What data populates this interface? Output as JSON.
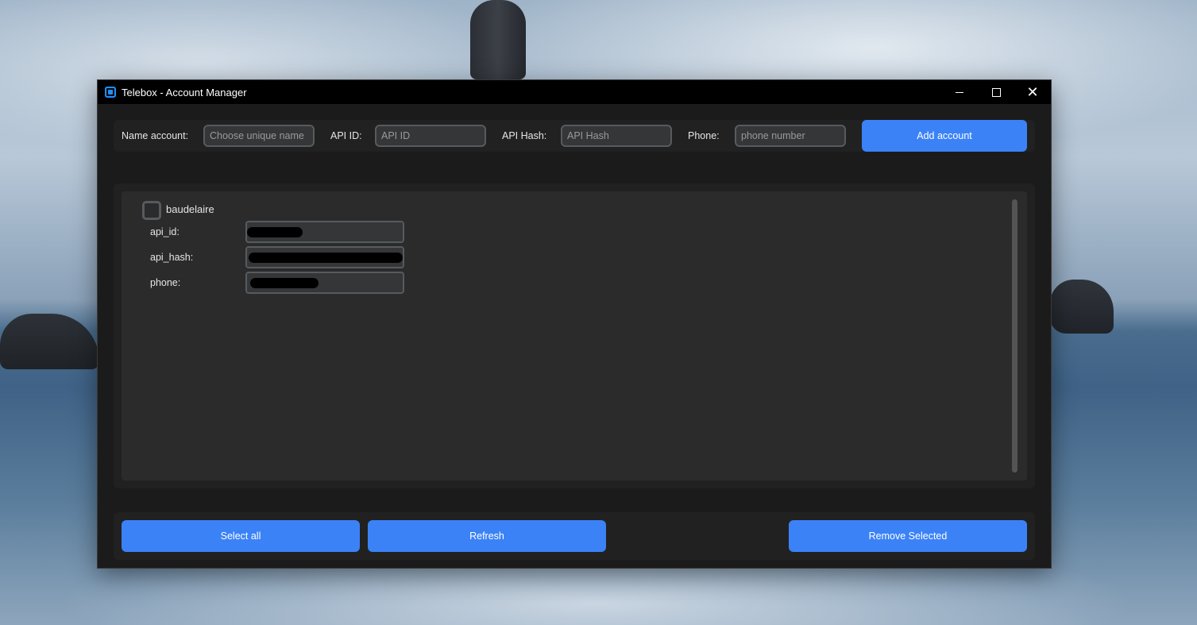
{
  "window": {
    "title": "Telebox - Account Manager",
    "close_glyph": "✕"
  },
  "form": {
    "name_label": "Name account:",
    "name_placeholder": "Choose unique name",
    "api_id_label": "API ID:",
    "api_id_placeholder": "API ID",
    "api_hash_label": "API Hash:",
    "api_hash_placeholder": "API Hash",
    "phone_label": "Phone:",
    "phone_placeholder": "phone number",
    "add_button": "Add account"
  },
  "accounts": [
    {
      "name": "baudelaire",
      "checked": false,
      "fields": [
        {
          "label": "api_id:",
          "value": ""
        },
        {
          "label": "api_hash:",
          "value": ""
        },
        {
          "label": "phone:",
          "value": ""
        }
      ]
    }
  ],
  "actions": {
    "select_all": "Select all",
    "refresh": "Refresh",
    "remove_selected": "Remove Selected"
  },
  "colors": {
    "accent": "#3b82f6",
    "window_bg": "#1b1b1b",
    "panel_bg": "#212121",
    "list_bg": "#2b2b2b",
    "field_bg": "#343638",
    "field_border": "#565b5e",
    "app_icon": "#1e90ff"
  },
  "icons": {
    "app": "app-square-icon",
    "minimize": "minimize-icon",
    "maximize": "maximize-icon",
    "close": "close-icon"
  }
}
